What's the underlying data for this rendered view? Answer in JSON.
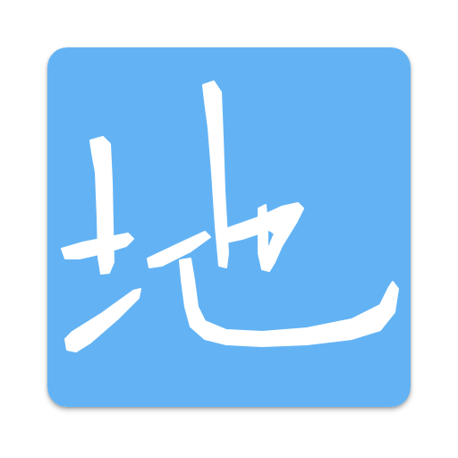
{
  "app_icon": {
    "glyph": "地",
    "icon_name": "calligraphy-di-icon",
    "background_color": "#63B3F4",
    "glyph_color": "#FFFFFF"
  }
}
